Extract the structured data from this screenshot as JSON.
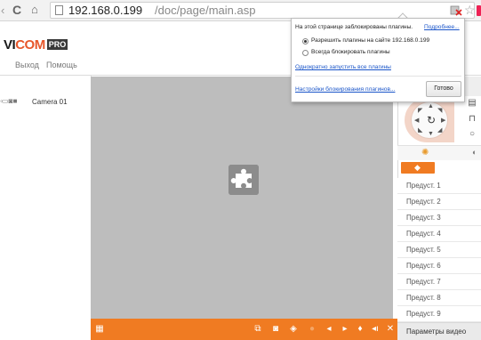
{
  "browser": {
    "url_host": "192.168.0.199",
    "url_path": "/doc/page/main.asp"
  },
  "app": {
    "logo_v": "VI",
    "logo_com": "COM",
    "logo_pro": "PRO",
    "nav": {
      "logout": "Выход",
      "help": "Помощь"
    }
  },
  "tree": {
    "camera_label": "Camera 01"
  },
  "toolbar_icons": [
    "grid-icon",
    "full-screen-icon",
    "snapshot-icon",
    "record-icon",
    "stop-icon",
    "prev-icon",
    "next-icon",
    "microphone-icon",
    "volume-icon",
    "close-icon"
  ],
  "presets": [
    "Предуст. 1",
    "Предуст. 2",
    "Предуст. 3",
    "Предуст. 4",
    "Предуст. 5",
    "Предуст. 6",
    "Предуст. 7",
    "Предуст. 8",
    "Предуст. 9"
  ],
  "video_params_label": "Параметры видео",
  "popup": {
    "message": "На этой странице заблокированы плагины.",
    "more_link": "Подробнее...",
    "option_allow": "Разрешить плагины на сайте 192.168.0.199",
    "option_block": "Всегда блокировать плагины",
    "run_once": "Однократно запустить все плагины",
    "manage": "Настройки блокирования плагинов...",
    "done": "Готово",
    "selected_option": "allow"
  },
  "colors": {
    "accent": "#f07b22",
    "link": "#1a55c9",
    "video_bg": "#bdbdbd"
  }
}
